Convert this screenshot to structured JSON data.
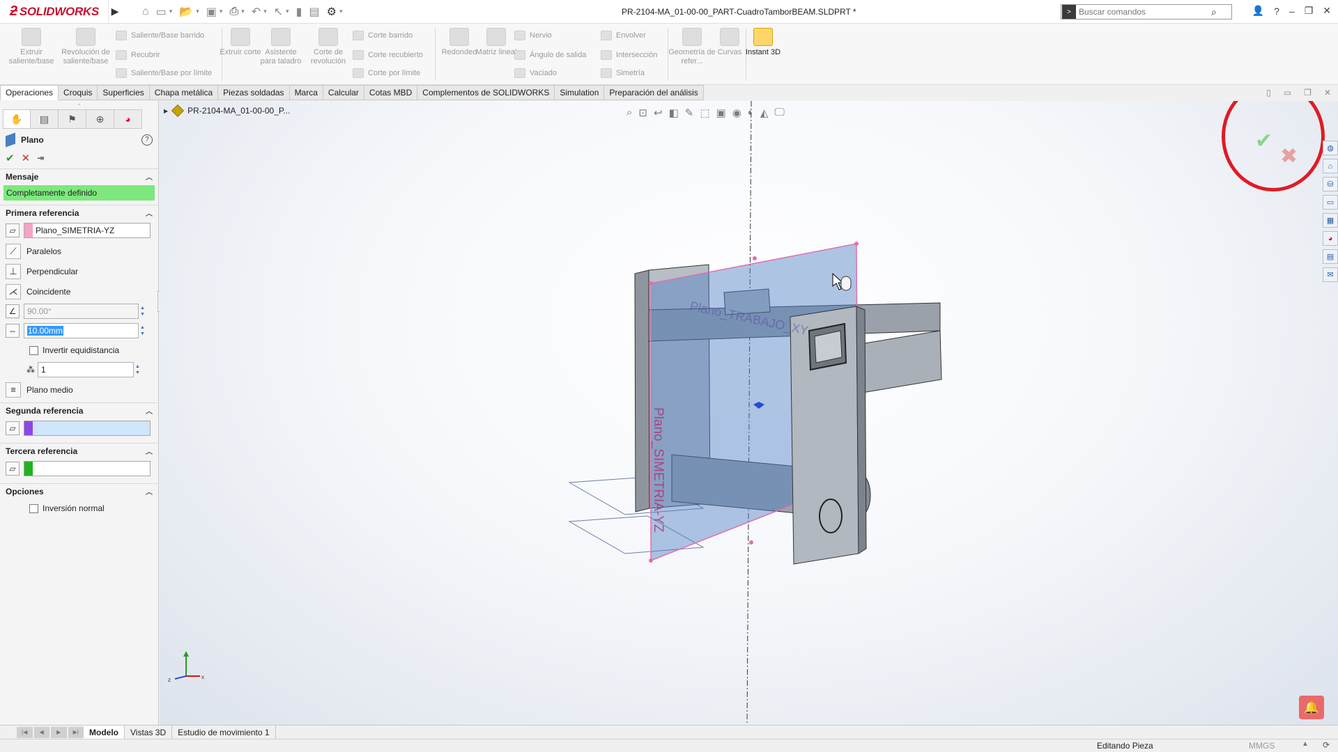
{
  "app": {
    "logo_text": "SOLIDWORKS",
    "document_title": "PR-2104-MA_01-00-00_PART-CuadroTamborBEAM.SLDPRT *",
    "search_placeholder": "Buscar comandos"
  },
  "ribbon": {
    "extrude_boss": "Extruir saliente/base",
    "revolve_boss": "Revolución de saliente/base",
    "swept_boss": "Saliente/Base barrido",
    "loft_boss": "Recubrir",
    "boundary_boss": "Saliente/Base por límite",
    "extrude_cut": "Extruir corte",
    "hole_wizard": "Asistente para taladro",
    "revolve_cut": "Corte de revolución",
    "swept_cut": "Corte barrido",
    "lofted_cut": "Corte recubierto",
    "boundary_cut": "Corte por límite",
    "fillet": "Redondeo",
    "linear_pattern": "Matriz lineal",
    "rib": "Nervio",
    "draft": "Ángulo de salida",
    "shell": "Vaciado",
    "wrap": "Envolver",
    "intersect": "Intersección",
    "mirror": "Simetría",
    "ref_geometry": "Geometría de refer...",
    "curves": "Curvas",
    "instant3d": "Instant 3D"
  },
  "tabs": [
    "Operaciones",
    "Croquis",
    "Superficies",
    "Chapa metálica",
    "Piezas soldadas",
    "Marca",
    "Calcular",
    "Cotas MBD",
    "Complementos de SOLIDWORKS",
    "Simulation",
    "Preparación del análisis"
  ],
  "tree": {
    "root_label": "PR-2104-MA_01-00-00_P..."
  },
  "property_manager": {
    "title": "Plano",
    "message_section": "Mensaje",
    "message_text": "Completamente definido",
    "first_ref_section": "Primera referencia",
    "first_ref_value": "Plano_SIMETRIA-YZ",
    "parallel": "Paralelos",
    "perpendicular": "Perpendicular",
    "coincident": "Coincidente",
    "angle_value": "90.00°",
    "distance_value": "10.00mm",
    "flip_offset": "Invertir equidistancia",
    "instances_value": "1",
    "mid_plane": "Plano medio",
    "second_ref_section": "Segunda referencia",
    "third_ref_section": "Tercera referencia",
    "options_section": "Opciones",
    "flip_normal": "Inversión normal",
    "first_ref_color": "#f6a3c8",
    "second_ref_color": "#8e44e6",
    "third_ref_color": "#1db41d"
  },
  "viewport": {
    "plane_label_1": "Plano_TRABAJO_XY",
    "plane_label_2": "Plano_SIMETRIA-YZ"
  },
  "bottom_tabs": [
    "Modelo",
    "Vistas 3D",
    "Estudio de movimiento 1"
  ],
  "status": {
    "mode": "Editando Pieza",
    "units": "MMGS"
  }
}
